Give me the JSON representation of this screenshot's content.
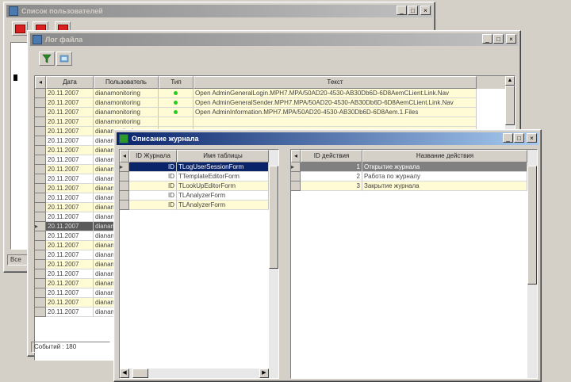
{
  "window_back": {
    "title": "Список пользователей",
    "status": "Все"
  },
  "window_mid": {
    "title": "Лог файла",
    "columns": [
      "Дата",
      "Пользователь",
      "Тип",
      "Текст"
    ],
    "first_row": {
      "date": "20.11.2007",
      "user": "dianamonitoring",
      "text": "Open AdminGeneralLogin.MPH7.MPA/50AD20-4530-AB30Db6D-6D8AemCLient.Link.Nav"
    },
    "rows": [
      {
        "date": "20.11.2007",
        "user": "dianamonitoring",
        "text": "Open AdminGeneralLogin.MPH7.MPA/50AD20-4530-AB30Db6D-6D8AemCLient.Link.Nav"
      },
      {
        "date": "20.11.2007",
        "user": "dianamonitoring",
        "text": "Open AdminGeneralSender.MPH7.MPA/50AD20-4530-AB30Db6D-6D8AemCLient.Link.Nav"
      },
      {
        "date": "20.11.2007",
        "user": "dianamonitoring",
        "text": "Open AdminInformation.MPH7.MPA/50AD20-4530-AB30Db6D-6D8Aem.1.Files"
      },
      {
        "date": "20.11.2007",
        "user": "dianamonitoring",
        "text": ""
      },
      {
        "date": "20.11.2007",
        "user": "dianamonitoring",
        "text": ""
      },
      {
        "date": "20.11.2007",
        "user": "dianamonitoring",
        "text": ""
      },
      {
        "date": "20.11.2007",
        "user": "dianamonitoring",
        "text": ""
      },
      {
        "date": "20.11.2007",
        "user": "dianamonitoring",
        "text": ""
      },
      {
        "date": "20.11.2007",
        "user": "dianamonitoring",
        "text": ""
      },
      {
        "date": "20.11.2007",
        "user": "dianamonitoring",
        "text": ""
      },
      {
        "date": "20.11.2007",
        "user": "dianamonitoring",
        "text": ""
      },
      {
        "date": "20.11.2007",
        "user": "dianamonitoring",
        "text": ""
      },
      {
        "date": "20.11.2007",
        "user": "dianamonitoring",
        "text": ""
      },
      {
        "date": "20.11.2007",
        "user": "dianamonitoring",
        "text": ""
      },
      {
        "date": "20.11.2007",
        "user": "dianamonitoring",
        "text": ""
      },
      {
        "date": "20.11.2007",
        "user": "dianamonitoring",
        "text": ""
      },
      {
        "date": "20.11.2007",
        "user": "dianamonitoring",
        "text": ""
      },
      {
        "date": "20.11.2007",
        "user": "dianamonitoring",
        "text": ""
      },
      {
        "date": "20.11.2007",
        "user": "dianamonitoring",
        "text": ""
      },
      {
        "date": "20.11.2007",
        "user": "dianamonitoring",
        "text": ""
      },
      {
        "date": "20.11.2007",
        "user": "dianamonitoring",
        "text": ""
      },
      {
        "date": "20.11.2007",
        "user": "dianamonitoring",
        "text": ""
      },
      {
        "date": "20.11.2007",
        "user": "dianamonitoring",
        "text": ""
      },
      {
        "date": "20.11.2007",
        "user": "dianamonitoring",
        "text": ""
      }
    ],
    "status": "Событий : 180"
  },
  "window_front": {
    "title": "Описание журнала",
    "left_columns": [
      "ID Журнала",
      "Имя таблицы"
    ],
    "left_rows": [
      {
        "id": "ID",
        "name": "TLogUserSessionForm"
      },
      {
        "id": "ID",
        "name": "TTemplateEditorForm"
      },
      {
        "id": "ID",
        "name": "TLookUpEditorForm"
      },
      {
        "id": "ID",
        "name": "TLAnalyzerForm"
      },
      {
        "id": "ID",
        "name": "TLAnalyzerForm"
      }
    ],
    "right_columns": [
      "ID действия",
      "Название действия"
    ],
    "right_rows": [
      {
        "id": "1",
        "name": "Открытие журнала"
      },
      {
        "id": "2",
        "name": "Работа по журналу"
      },
      {
        "id": "3",
        "name": "Закрытие журнала"
      }
    ]
  },
  "colors": {
    "title_active": "#0a246a",
    "row_yellow": "#fffbd4",
    "status_dot": "#1fd01f",
    "tool_red": "#d82020"
  }
}
